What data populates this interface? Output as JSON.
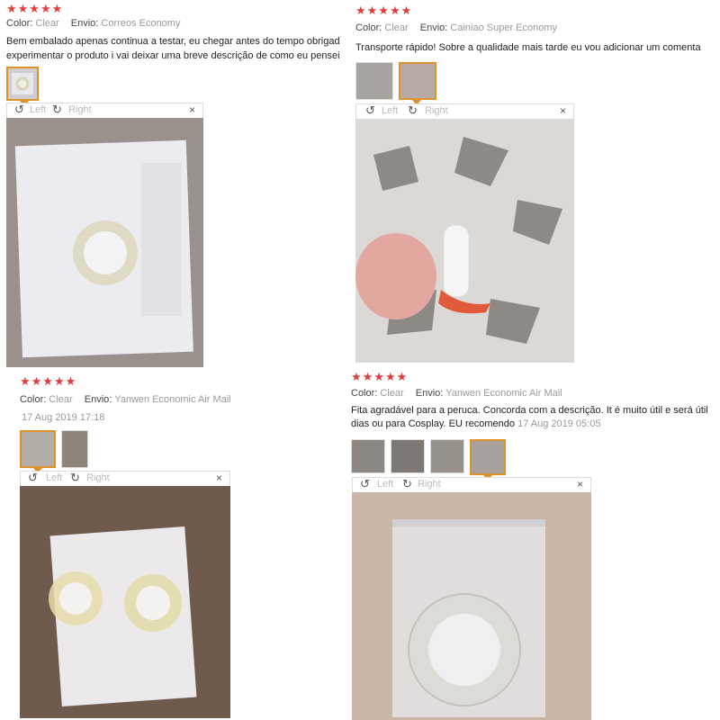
{
  "reviews": [
    {
      "stars": "★★★★★",
      "color_label": "Color:",
      "color_value": "Clear",
      "ship_label": "Envio:",
      "ship_value": "Correos Economy",
      "text_line1": "Bem embalado apenas continua a testar, eu chegar antes do tempo obrigado v",
      "text_line2": "experimentar o produto i vai deixar uma breve descrição de como eu pensei, g"
    },
    {
      "stars": "★★★★★",
      "color_label": "Color:",
      "color_value": "Clear",
      "ship_label": "Envio:",
      "ship_value": "Cainiao Super Economy",
      "text_line1": "Transporte rápido! Sobre a qualidade mais tarde eu vou adicionar um comenta"
    },
    {
      "stars": "★★★★★",
      "color_label": "Color:",
      "color_value": "Clear",
      "ship_label": "Envio:",
      "ship_value": "Yanwen Economic Air Mail",
      "date": "17 Aug 2019 17:18"
    },
    {
      "stars": "★★★★★",
      "color_label": "Color:",
      "color_value": "Clear",
      "ship_label": "Envio:",
      "ship_value": "Yanwen Economic Air Mail",
      "text_line1": "Fita agradável para a peruca. Concorda com a descrição. It é muito útil e será útil",
      "text_line2": "dias ou para Cosplay. EU recomendo",
      "date": "17 Aug 2019 05:05"
    }
  ],
  "toolbar": {
    "left_label": "Left",
    "right_label": "Right",
    "close": "×",
    "rotate_left_icon": "↺",
    "rotate_right_icon": "↻"
  },
  "colors": {
    "star": "#e23b3b",
    "selected_thumb": "#e0922a"
  }
}
